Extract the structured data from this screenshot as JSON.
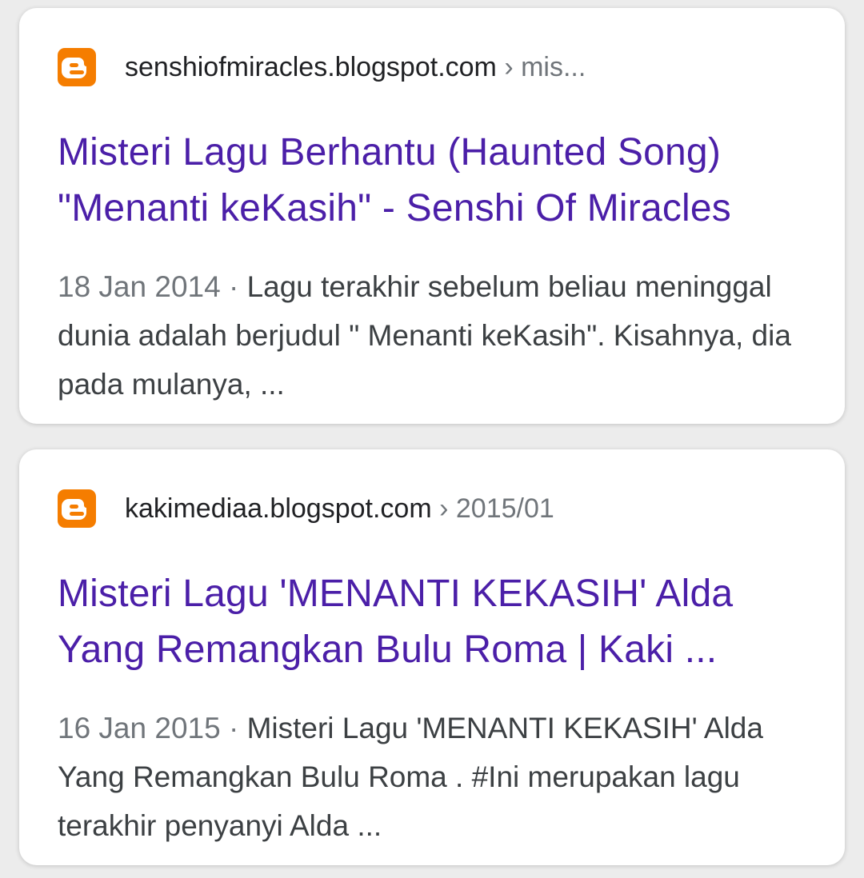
{
  "results": [
    {
      "domain": "senshiofmiracles.blogspot.com",
      "path": " › mis...",
      "favicon_icon": "blogger-icon",
      "title": "Misteri Lagu Berhantu (Haunted Song) \"Menanti keKasih\" - Senshi Of Miracles",
      "date": "18 Jan 2014 · ",
      "snippet": "Lagu terakhir sebelum beliau meninggal dunia adalah berjudul \" Menanti keKasih\". Kisahnya, dia pada mulanya, ..."
    },
    {
      "domain": "kakimediaa.blogspot.com",
      "path": " › 2015/01",
      "favicon_icon": "blogger-icon",
      "title": "Misteri Lagu 'MENANTI KEKASIH' Alda Yang Remangkan Bulu Roma | Kaki ...",
      "date": "16 Jan 2015 · ",
      "snippet": "Misteri Lagu 'MENANTI KEKASIH' Alda Yang Remangkan Bulu Roma . #Ini merupakan lagu terakhir penyanyi Alda  ..."
    }
  ],
  "colors": {
    "title": "#4b1fa8",
    "favicon": "#f57d00",
    "snippet": "#3c4043",
    "muted": "#70757a"
  }
}
